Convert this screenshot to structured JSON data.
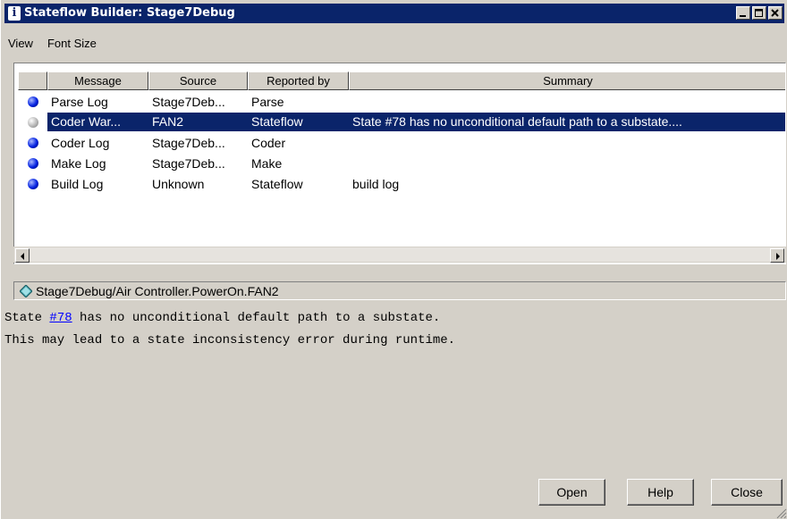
{
  "window": {
    "title": "Stateflow Builder: Stage7Debug",
    "title_icon": "info-icon",
    "controls": [
      "minimize-icon",
      "maximize-icon",
      "close-icon"
    ]
  },
  "menu": [
    "View",
    "Font Size"
  ],
  "table": {
    "columns": [
      "",
      "Message",
      "Source",
      "Reported by",
      "Summary"
    ],
    "rows": [
      {
        "icon": "blue-dot-icon",
        "message": "Parse Log",
        "source": "Stage7Deb...",
        "reported_by": "Parse",
        "summary": "",
        "selected": false
      },
      {
        "icon": "grey-dot-icon",
        "message": "Coder War...",
        "source": "FAN2",
        "reported_by": "Stateflow",
        "summary": "State #78 has no unconditional default path to a substate....",
        "selected": true
      },
      {
        "icon": "blue-dot-icon",
        "message": "Coder Log",
        "source": "Stage7Deb...",
        "reported_by": "Coder",
        "summary": "",
        "selected": false
      },
      {
        "icon": "blue-dot-icon",
        "message": "Make Log",
        "source": "Stage7Deb...",
        "reported_by": "Make",
        "summary": "",
        "selected": false
      },
      {
        "icon": "blue-dot-icon",
        "message": "Build Log",
        "source": "Unknown",
        "reported_by": "Stateflow",
        "summary": "build log",
        "selected": false
      }
    ]
  },
  "details": {
    "path": "Stage7Debug/Air Controller.PowerOn.FAN2",
    "path_icon": "state-diamond-icon",
    "line1_prefix": "State ",
    "line1_link": "#78",
    "line1_suffix": " has no unconditional default path to a substate.",
    "line2": "This may lead to a state inconsistency error during runtime."
  },
  "buttons": {
    "open": "Open",
    "help": "Help",
    "close": "Close"
  },
  "colors": {
    "titlebar": "#0a246a",
    "selection": "#0a246a",
    "face": "#d4d0c8",
    "link": "#0000ff"
  }
}
